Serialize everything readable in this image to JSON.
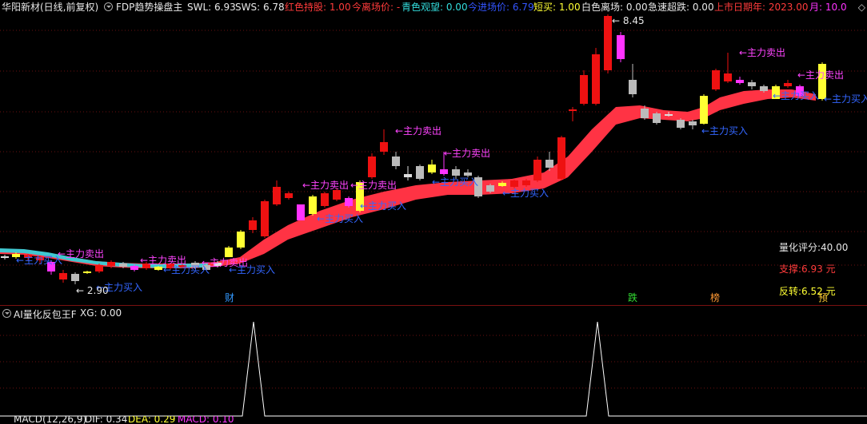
{
  "header": {
    "title": "华阳新材(日线,前复权)",
    "indicator_name": "FDP趋势操盘主",
    "items": [
      {
        "label": "SWL: 6.93",
        "color": "#e8e8e8"
      },
      {
        "label": "SWS: 6.78",
        "color": "#e8e8e8"
      },
      {
        "label": "红色持股: 1.00",
        "color": "#ff3b3b"
      },
      {
        "label": "今离场价: -",
        "color": "#ff3b3b"
      },
      {
        "label": "青色观望: 0.00",
        "color": "#33dddd"
      },
      {
        "label": "今进场价: 6.79",
        "color": "#3355ff"
      },
      {
        "label": "短买: 1.00",
        "color": "#ffff33"
      },
      {
        "label": "白色离场: 0.00",
        "color": "#e8e8e8"
      },
      {
        "label": "急速超跌: 0.00",
        "color": "#e8e8e8"
      },
      {
        "label": "上市日期年: 2023.00",
        "color": "#ff3b3b"
      },
      {
        "label": "月: 10.0",
        "color": "#ff33ff"
      }
    ]
  },
  "main_chart": {
    "annotations": {
      "sell": "←主力卖出",
      "buy": "←主力买入",
      "high_price": "8.45",
      "low_price": "2.90"
    },
    "markers": [
      {
        "label": "财",
        "color": "#3399ff"
      },
      {
        "label": "跌",
        "color": "#33dd33"
      },
      {
        "label": "榜",
        "color": "#ff9933"
      },
      {
        "label": "预",
        "color": "#ffcc33"
      }
    ],
    "side_panel": {
      "score": "量化评分:40.00",
      "support": "支撑:6.93 元",
      "reversal": "反转:6.52 元"
    }
  },
  "sub_chart": {
    "title": "AI量化反包王F",
    "xg": "XG: 0.00"
  },
  "bottom_indicator": {
    "name": "MACD(12,26,9)",
    "dif": "DIF: 0.34",
    "dea": "DEA: 0.29",
    "macd": "MACD: 0.10"
  },
  "colors": {
    "background": "#000000",
    "up": "#ee1111",
    "ribbon": "#ff3344",
    "cyan": "#40c8d0",
    "magenta": "#ff33ff",
    "yellow": "#ffff33",
    "gray": "#bbbbbb",
    "buy_text": "#3366ff",
    "sell_text": "#ff44ff"
  }
}
